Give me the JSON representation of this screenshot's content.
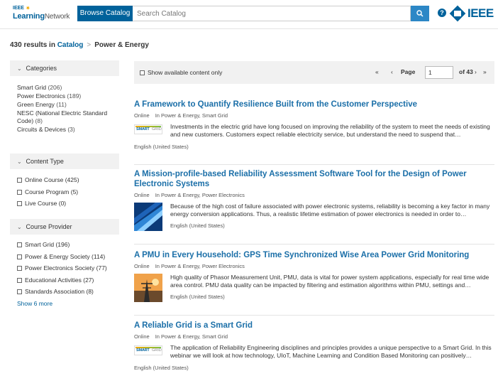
{
  "header": {
    "logo_line1": "IEEE",
    "logo_line2_a": "Learning",
    "logo_line2_b": "Network",
    "browse_label": "Browse Catalog",
    "search_placeholder": "Search Catalog",
    "help_label": "?",
    "ieee_brand": "IEEE"
  },
  "breadcrumb": {
    "count_text": "430 results in",
    "catalog": "Catalog",
    "separator": ">",
    "current": "Power & Energy"
  },
  "sidebar": {
    "categories": {
      "label": "Categories",
      "items": [
        {
          "name": "Smart Grid",
          "count": "(206)"
        },
        {
          "name": "Power Electronics",
          "count": "(189)"
        },
        {
          "name": "Green Energy",
          "count": "(11)"
        },
        {
          "name": "NESC (National Electric Standard Code)",
          "count": "(8)"
        },
        {
          "name": "Circuits & Devices",
          "count": "(3)"
        }
      ]
    },
    "content_type": {
      "label": "Content Type",
      "items": [
        {
          "name": "Online Course",
          "count": "(425)"
        },
        {
          "name": "Course Program",
          "count": "(5)"
        },
        {
          "name": "Live Course",
          "count": "(0)"
        }
      ]
    },
    "course_provider": {
      "label": "Course Provider",
      "items": [
        {
          "name": "Smart Grid",
          "count": "(196)"
        },
        {
          "name": "Power & Energy Society",
          "count": "(114)"
        },
        {
          "name": "Power Electronics Society",
          "count": "(77)"
        },
        {
          "name": "Educational Activities",
          "count": "(27)"
        },
        {
          "name": "Standards Association",
          "count": "(8)"
        }
      ],
      "show_more": "Show 6 more"
    }
  },
  "toolbar": {
    "show_available": "Show available content only",
    "page_label": "Page",
    "page_value": "1",
    "of_pages": "of 43",
    "first": "«",
    "prev": "‹",
    "next": "›",
    "last": "»"
  },
  "results": [
    {
      "title": "A Framework to Quantify Resilience Built from the Customer Perspective",
      "format": "Online",
      "in": "In Power & Energy, Smart Grid",
      "desc": "Investments in the electric grid have long focused on improving the reliability of the system to meet the needs of existing and new customers. Customers expect reliable electricity service, but understand the need to suspend that…",
      "lang": "English (United States)",
      "thumb": "smart-grid"
    },
    {
      "title": "A Mission-profile-based Reliability Assessment Software Tool for the Design of Power Electronic Systems",
      "format": "Online",
      "in": "In Power & Energy, Power Electronics",
      "desc": "Because of the high cost of failure associated with power electronic systems, reliability is becoming a key factor in many energy conversion applications. Thus, a realistic lifetime estimation of power electronics is needed in order to…",
      "lang": "English (United States)",
      "thumb": "abstract-blue"
    },
    {
      "title": "A PMU in Every Household: GPS Time Synchronized Wise Area Power Grid Monitoring",
      "format": "Online",
      "in": "In Power & Energy, Power Electronics",
      "desc": "High quality of Phasor Measurement Unit, PMU, data is vital for power system applications, especially for real time wide area control. PMU data quality can be impacted by filtering and estimation algorithms within PMU, settings and…",
      "lang": "English (United States)",
      "thumb": "power-tower"
    },
    {
      "title": "A Reliable Grid is a Smart Grid",
      "format": "Online",
      "in": "In Power & Energy, Smart Grid",
      "desc": "The application of Reliability Engineering disciplines and principles provides a unique perspective to a Smart Grid. In this webinar we will look at how technology, UIoT, Machine Learning and Condition Based Monitoring can positively…",
      "lang": "English (United States)",
      "thumb": "smart-grid"
    }
  ],
  "thumb_text": {
    "smart": "SMART",
    "grid": "GRID"
  },
  "colors": {
    "primary": "#00629b",
    "link": "#1b6fa8",
    "search_btn": "#2c87c6",
    "panel": "#f1f1f1"
  }
}
